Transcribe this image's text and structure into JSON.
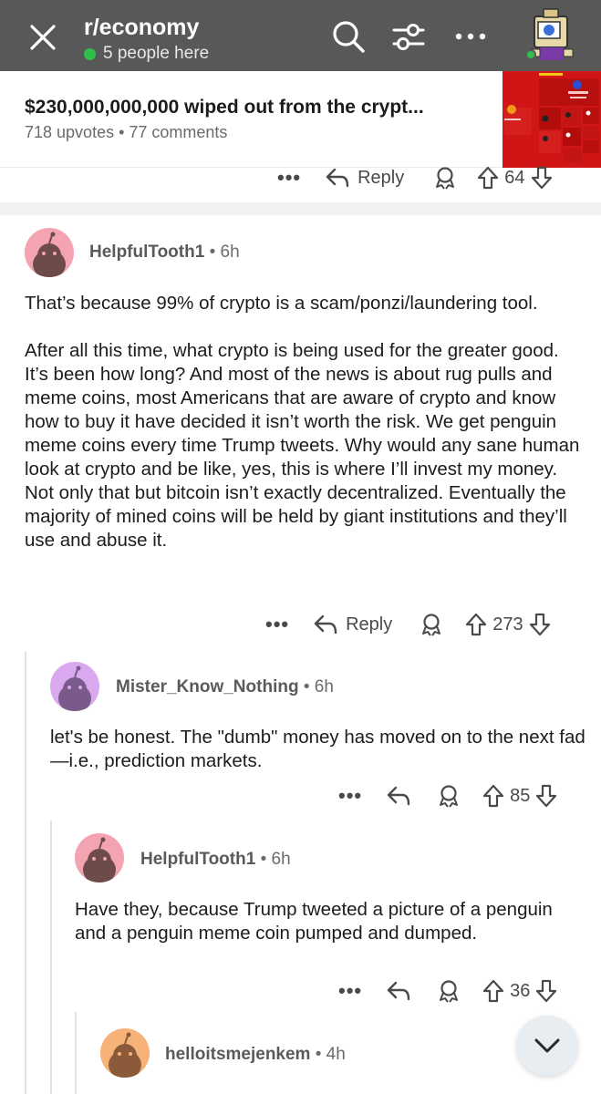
{
  "header": {
    "subreddit": "r/economy",
    "online": "5 people here"
  },
  "pinned_post": {
    "title": "$230,000,000,000 wiped out from the crypt...",
    "meta": "718 upvotes • 77 comments"
  },
  "top_actions": {
    "reply": "Reply",
    "votes": "64"
  },
  "comments": [
    {
      "user": "HelpfulTooth1",
      "time": "• 6h",
      "body1": "That’s because 99% of crypto is a scam/ponzi/laundering tool.",
      "body2": "After all this time, what crypto is being used for the greater good. It’s been how long? And most of the news is about rug pulls and meme coins, most Americans that are aware of crypto and know how to buy it have decided it isn’t worth the risk.  We get penguin meme coins every time Trump tweets. Why would any sane human look at crypto and be like, yes, this is where I’ll invest my money.  Not only that but bitcoin isn’t exactly decentralized. Eventually the majority of mined coins will be held by giant institutions and they’ll use and abuse it.",
      "reply": "Reply",
      "votes": "273"
    },
    {
      "user": "Mister_Know_Nothing",
      "time": "• 6h",
      "body1": "let's be honest. The \"dumb\" money has moved on to the next fad—i.e., prediction markets.",
      "votes": "85"
    },
    {
      "user": "HelpfulTooth1",
      "time": "• 6h",
      "body1": "Have they, because Trump tweeted a picture of a penguin and a penguin meme coin pumped and dumped.",
      "votes": "36"
    },
    {
      "user": "helloitsmejenkem",
      "time": "• 4h"
    }
  ],
  "colors": {
    "header_bg": "#585858",
    "online_dot": "#2fbf4a",
    "avatar_pink": "#f4a3b1",
    "avatar_purple": "#d9a8ee",
    "avatar_orange": "#f7b27a"
  }
}
